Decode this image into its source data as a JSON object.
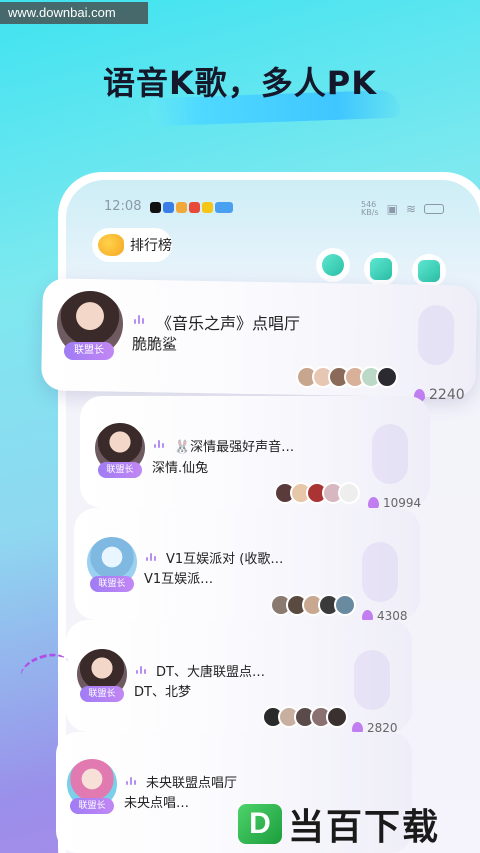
{
  "watermark": "www.downbai.com",
  "headline": "语音K歌，多人PK",
  "statusbar": {
    "time": "12:08",
    "net_speed": "546\nKB/s"
  },
  "header": {
    "rank_label": "排行榜"
  },
  "colors": {
    "accent_purple": "#b48ff0",
    "badge_gradient": [
      "#9f7cf5",
      "#c287f4"
    ],
    "teal": "#2bbfa6"
  },
  "icons": {
    "rank": "hand-pointer-icon",
    "chat": "chat-bubble-icon",
    "home_add": "home-plus-icon",
    "task": "check-doc-icon"
  },
  "rooms": [
    {
      "title": "《音乐之声》点唱厅",
      "host": "脆脆鲨",
      "badge": "联盟长",
      "heat": "2240"
    },
    {
      "title": "🐰深情最强好声音…",
      "host": "深情.仙兔",
      "badge": "联盟长",
      "heat": "10994"
    },
    {
      "title": "V1互娱派对 (收歌…",
      "host": "V1互娱派…",
      "badge": "联盟长",
      "heat": "4308"
    },
    {
      "title": "DT、大唐联盟点…",
      "host": "DT、北梦",
      "badge": "联盟长",
      "heat": "2820"
    },
    {
      "title": "未央联盟点唱厅",
      "host": "未央点唱…",
      "badge": "联盟长",
      "heat": ""
    }
  ],
  "brand": {
    "logo_letter": "D",
    "name": "当百下载"
  }
}
